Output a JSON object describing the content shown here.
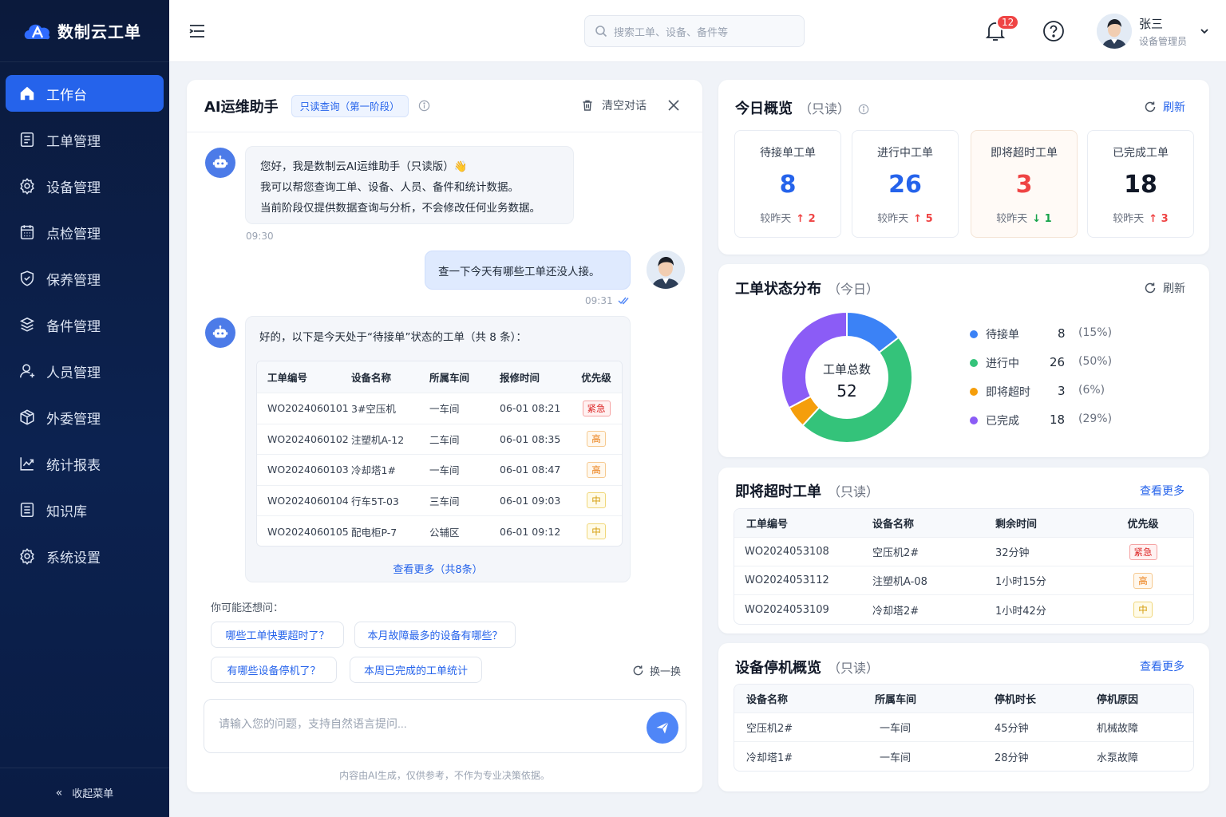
{
  "app": {
    "name": "数制云工单"
  },
  "sidebar": {
    "items": [
      {
        "label": "工作台",
        "icon": "home-icon"
      },
      {
        "label": "工单管理",
        "icon": "document-icon"
      },
      {
        "label": "设备管理",
        "icon": "gear-icon"
      },
      {
        "label": "点检管理",
        "icon": "calendar-icon"
      },
      {
        "label": "保养管理",
        "icon": "shield-check-icon"
      },
      {
        "label": "备件管理",
        "icon": "box-icon"
      },
      {
        "label": "人员管理",
        "icon": "user-icon"
      },
      {
        "label": "外委管理",
        "icon": "package-icon"
      },
      {
        "label": "统计报表",
        "icon": "chart-icon"
      },
      {
        "label": "知识库",
        "icon": "book-icon"
      },
      {
        "label": "系统设置",
        "icon": "settings-icon"
      }
    ],
    "collapse_label": "收起菜单"
  },
  "topbar": {
    "search_placeholder": "搜索工单、设备、备件等",
    "notification_count": "12",
    "user_name": "张三",
    "user_role": "设备管理员"
  },
  "chat": {
    "title": "AI运维助手",
    "mode_tag": "只读查询（第一阶段）",
    "clear_label": "清空对话",
    "greeting_lines": [
      "您好，我是数制云AI运维助手（只读版）👋",
      "我可以帮您查询工单、设备、人员、备件和统计数据。",
      "当前阶段仅提供数据查询与分析，不会修改任何业务数据。"
    ],
    "greeting_time": "09:30",
    "user_message": "查一下今天有哪些工单还没人接。",
    "user_time": "09:31",
    "reply_intro": "好的，以下是今天处于“待接单”状态的工单（共 8 条）：",
    "table_headers": [
      "工单编号",
      "设备名称",
      "所属车间",
      "报修时间",
      "优先级"
    ],
    "table_rows": [
      {
        "id": "WO2024060101",
        "device": "3#空压机",
        "workshop": "一车间",
        "time": "06-01 08:21",
        "priority": "紧急",
        "level": "urgent"
      },
      {
        "id": "WO2024060102",
        "device": "注塑机A-12",
        "workshop": "二车间",
        "time": "06-01 08:35",
        "priority": "高",
        "level": "high"
      },
      {
        "id": "WO2024060103",
        "device": "冷却塔1#",
        "workshop": "一车间",
        "time": "06-01 08:47",
        "priority": "高",
        "level": "high"
      },
      {
        "id": "WO2024060104",
        "device": "行车5T-03",
        "workshop": "三车间",
        "time": "06-01 09:03",
        "priority": "中",
        "level": "mid"
      },
      {
        "id": "WO2024060105",
        "device": "配电柜P-7",
        "workshop": "公辅区",
        "time": "06-01 09:12",
        "priority": "中",
        "level": "mid"
      }
    ],
    "more_link": "查看更多（共8条）",
    "suggest_title": "你可能还想问：",
    "suggestions": [
      "哪些工单快要超时了？",
      "本月故障最多的设备有哪些？",
      "有哪些设备停机了？",
      "本周已完成的工单统计"
    ],
    "refresh_label": "换一换",
    "input_placeholder": "请输入您的问题，支持自然语言提问...",
    "disclaimer": "内容由AI生成，仅供参考，不作为专业决策依据。"
  },
  "overview": {
    "title": "今日概览",
    "sub": "（只读）",
    "refresh_label": "刷新",
    "cards": [
      {
        "label": "待接单工单",
        "value": "8",
        "compare": "较昨天",
        "delta": "↑ 2",
        "color": "#2563eb",
        "delta_color": "#ef4444"
      },
      {
        "label": "进行中工单",
        "value": "26",
        "compare": "较昨天",
        "delta": "↑ 5",
        "color": "#2563eb",
        "delta_color": "#ef4444"
      },
      {
        "label": "即将超时工单",
        "value": "3",
        "compare": "较昨天",
        "delta": "↓ 1",
        "color": "#ef4444",
        "delta_color": "#16a34a"
      },
      {
        "label": "已完成工单",
        "value": "18",
        "compare": "较昨天",
        "delta": "↑ 3",
        "color": "#111827",
        "delta_color": "#ef4444"
      }
    ]
  },
  "distribution": {
    "title": "工单状态分布",
    "sub": "（今日）",
    "refresh_label": "刷新",
    "center_label": "工单总数",
    "total": "52",
    "items": [
      {
        "name": "待接单",
        "value": "8",
        "pct": "(15%)",
        "color": "#3b82f6"
      },
      {
        "name": "进行中",
        "value": "26",
        "pct": "(50%)",
        "color": "#34c37a"
      },
      {
        "name": "即将超时",
        "value": "3",
        "pct": "(6%)",
        "color": "#f59e0b"
      },
      {
        "name": "已完成",
        "value": "18",
        "pct": "(29%)",
        "color": "#8b5cf6"
      }
    ]
  },
  "chart_data": {
    "type": "pie",
    "categories": [
      "待接单",
      "进行中",
      "即将超时",
      "已完成"
    ],
    "values": [
      8,
      26,
      3,
      18
    ],
    "title": "工单状态分布"
  },
  "soon": {
    "title": "即将超时工单",
    "sub": "（只读）",
    "more": "查看更多",
    "headers": [
      "工单编号",
      "设备名称",
      "剩余时间",
      "优先级"
    ],
    "rows": [
      {
        "id": "WO2024053108",
        "device": "空压机2#",
        "remain": "32分钟",
        "priority": "紧急",
        "level": "urgent"
      },
      {
        "id": "WO2024053112",
        "device": "注塑机A-08",
        "remain": "1小时15分",
        "priority": "高",
        "level": "high"
      },
      {
        "id": "WO2024053109",
        "device": "冷却塔2#",
        "remain": "1小时42分",
        "priority": "中",
        "level": "mid"
      }
    ]
  },
  "downtime": {
    "title": "设备停机概览",
    "sub": "（只读）",
    "more": "查看更多",
    "headers": [
      "设备名称",
      "所属车间",
      "停机时长",
      "停机原因"
    ],
    "rows": [
      {
        "device": "空压机2#",
        "workshop": "一车间",
        "duration": "45分钟",
        "reason": "机械故障"
      },
      {
        "device": "冷却塔1#",
        "workshop": "一车间",
        "duration": "28分钟",
        "reason": "水泵故障"
      }
    ]
  }
}
